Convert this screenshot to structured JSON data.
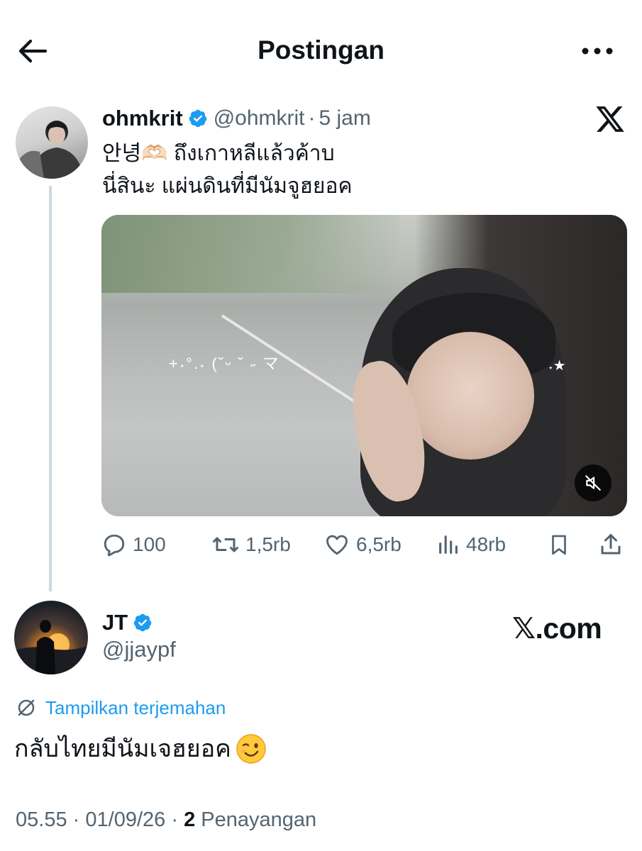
{
  "header": {
    "title": "Postingan",
    "back_icon": "arrow-left-icon",
    "more_icon": "more-horizontal-icon"
  },
  "original_post": {
    "author": {
      "name": "ohmkrit",
      "handle": "@ohmkrit",
      "verified": true
    },
    "separator": "·",
    "time": "5 jam",
    "text_line1": "안녕🫶🏻 ถึงเกาหลีแล้วค้าบ",
    "text_line2": "นี่สินะ แผ่นดินที่มีนัมจูฮยอค",
    "media": {
      "type": "video",
      "sticker_text": "+˖°.˖ (˘ᵕ ˘ ˶ マ",
      "sticker_text2": "˖★",
      "mute_icon": "volume-muted-icon"
    },
    "actions": {
      "replies": "100",
      "reposts": "1,5rb",
      "likes": "6,5rb",
      "views": "48rb"
    }
  },
  "reply": {
    "author": {
      "name": "JT",
      "handle": "@jjaypf",
      "verified": true
    },
    "source_label": "𝕏.com",
    "translate_label": "Tampilkan terjemahan",
    "text": "กลับไทยมีนัมเจฮยอค",
    "emoji": "wink-emoji",
    "meta": {
      "time": "05.55",
      "dot1": "·",
      "date": "01/09/26",
      "dot2": "·",
      "views_count": "2",
      "views_label": "Penayangan"
    }
  },
  "colors": {
    "text_primary": "#0f1419",
    "text_secondary": "#536471",
    "accent_blue": "#1d9bf0",
    "thread_line": "#cfd9de"
  }
}
